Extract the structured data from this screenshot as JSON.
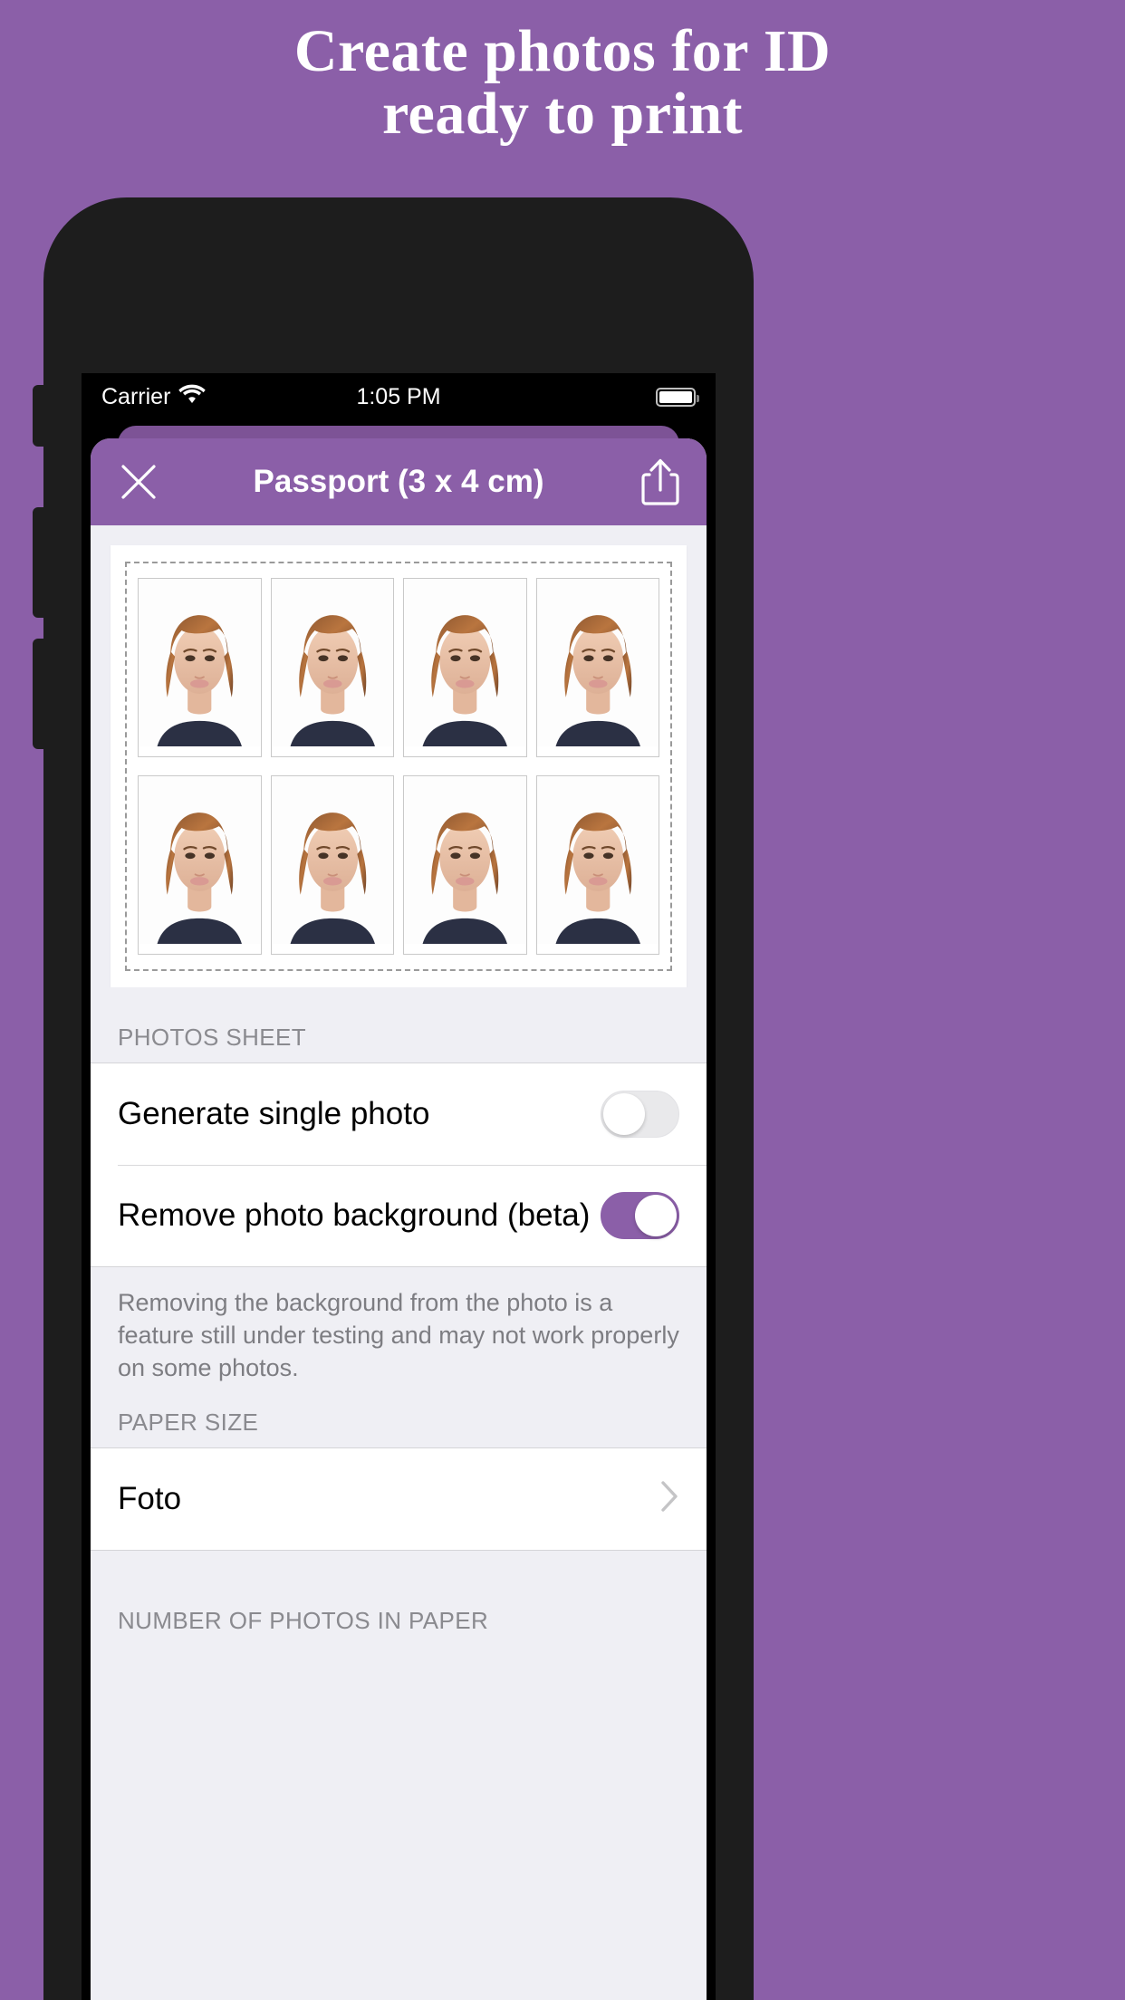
{
  "promo": {
    "headline_line1": "Create photos for ID",
    "headline_line2": "ready to print",
    "background_color": "#8B5FA8"
  },
  "status_bar": {
    "carrier": "Carrier",
    "wifi_icon": "wifi-icon",
    "time": "1:05 PM",
    "battery_icon": "battery-full-icon"
  },
  "navbar": {
    "close_icon": "close-x-icon",
    "title": "Passport (3 x 4 cm)",
    "share_icon": "share-export-icon",
    "accent_color": "#8B5FA8"
  },
  "photo_sheet": {
    "rows": 2,
    "columns": 4,
    "total_photos": 8,
    "photo_alt": "passport-portrait"
  },
  "sections": [
    {
      "header": "PHOTOS SHEET",
      "rows": [
        {
          "label": "Generate single photo",
          "control": "toggle",
          "value": "off"
        },
        {
          "label": "Remove photo background (beta)",
          "control": "toggle",
          "value": "on"
        }
      ],
      "footer": "Removing the background from the photo is a feature still under testing and may not work properly on some photos."
    },
    {
      "header": "PAPER SIZE",
      "rows": [
        {
          "label": "Foto",
          "control": "chevron",
          "value": ""
        }
      ],
      "footer": ""
    },
    {
      "header": "NUMBER OF PHOTOS IN PAPER",
      "rows": [],
      "footer": ""
    }
  ]
}
